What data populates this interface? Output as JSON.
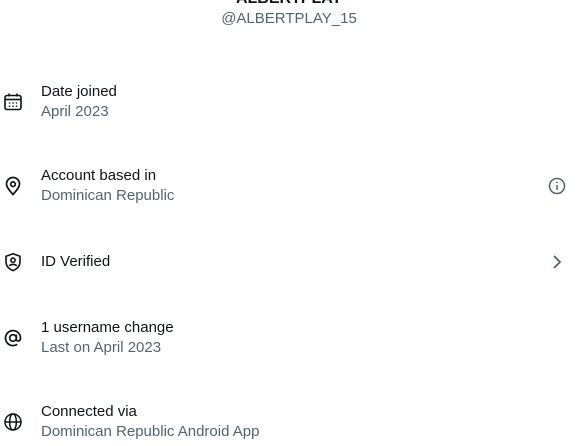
{
  "profile": {
    "name": "ALBERTPLAY",
    "handle": "@ALBERTPLAY_15"
  },
  "colors": {
    "primary_text": "#0f1419",
    "secondary_text": "#536471"
  },
  "rows": [
    {
      "icon": "calendar-icon",
      "title": "Date joined",
      "subtitle": "April 2023"
    },
    {
      "icon": "location-pin-icon",
      "title": "Account based in",
      "subtitle": "Dominican Republic",
      "trailing_icon": "info-icon"
    },
    {
      "icon": "verified-shield-icon",
      "title": "ID Verified",
      "trailing_icon": "chevron-right-icon"
    },
    {
      "icon": "at-sign-icon",
      "title": "1 username change",
      "subtitle": "Last on April 2023"
    },
    {
      "icon": "globe-icon",
      "title": "Connected via",
      "subtitle": "Dominican Republic Android App"
    }
  ]
}
